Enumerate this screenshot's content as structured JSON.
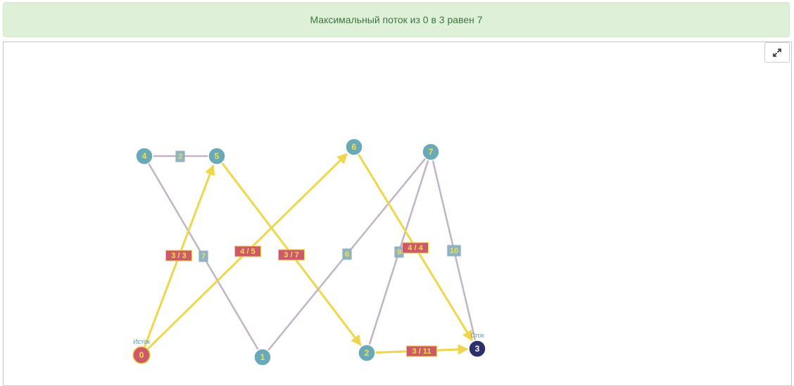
{
  "result_banner": {
    "text": "Максимальный поток из 0 в 3 равен 7"
  },
  "toolbar": {
    "expand_icon": "expand-arrows-icon"
  },
  "colors": {
    "node_fill": "#6aaab8",
    "source_fill": "#cc5a6a",
    "sink_fill": "#2c2f6b",
    "node_text": "#f2e04a",
    "sink_text": "#ffffff",
    "edge_idle": "#c2b4c6",
    "edge_flow": "#f0d64a",
    "label_idle_fill": "#8fb3c2",
    "label_flow_fill": "#cc5a6a",
    "label_text": "#f2e04a",
    "role_text": "#5a9bb0"
  },
  "graph": {
    "nodes": [
      {
        "id": "4",
        "label": "4",
        "role": ""
      },
      {
        "id": "5",
        "label": "5",
        "role": ""
      },
      {
        "id": "6",
        "label": "6",
        "role": ""
      },
      {
        "id": "7",
        "label": "7",
        "role": ""
      },
      {
        "id": "0",
        "label": "0",
        "role": "Исток",
        "kind": "source"
      },
      {
        "id": "1",
        "label": "1",
        "role": ""
      },
      {
        "id": "2",
        "label": "2",
        "role": ""
      },
      {
        "id": "3",
        "label": "3",
        "role": "Сток",
        "kind": "sink"
      }
    ],
    "edges": [
      {
        "from": "4",
        "to": "5",
        "label": "2",
        "flow": false
      },
      {
        "from": "4",
        "to": "1",
        "label": "7",
        "flow": false
      },
      {
        "from": "0",
        "to": "5",
        "label": "3 / 3",
        "flow": true
      },
      {
        "from": "0",
        "to": "6",
        "label": "4 / 5",
        "flow": true
      },
      {
        "from": "5",
        "to": "2",
        "label": "3 / 7",
        "flow": true
      },
      {
        "from": "1",
        "to": "7",
        "label": "6",
        "flow": false
      },
      {
        "from": "2",
        "to": "7",
        "label": "9",
        "flow": false
      },
      {
        "from": "6",
        "to": "3",
        "label": "4 / 4",
        "flow": true
      },
      {
        "from": "7",
        "to": "3",
        "label": "10",
        "flow": false
      },
      {
        "from": "2",
        "to": "3",
        "label": "3 / 11",
        "flow": true
      }
    ]
  }
}
